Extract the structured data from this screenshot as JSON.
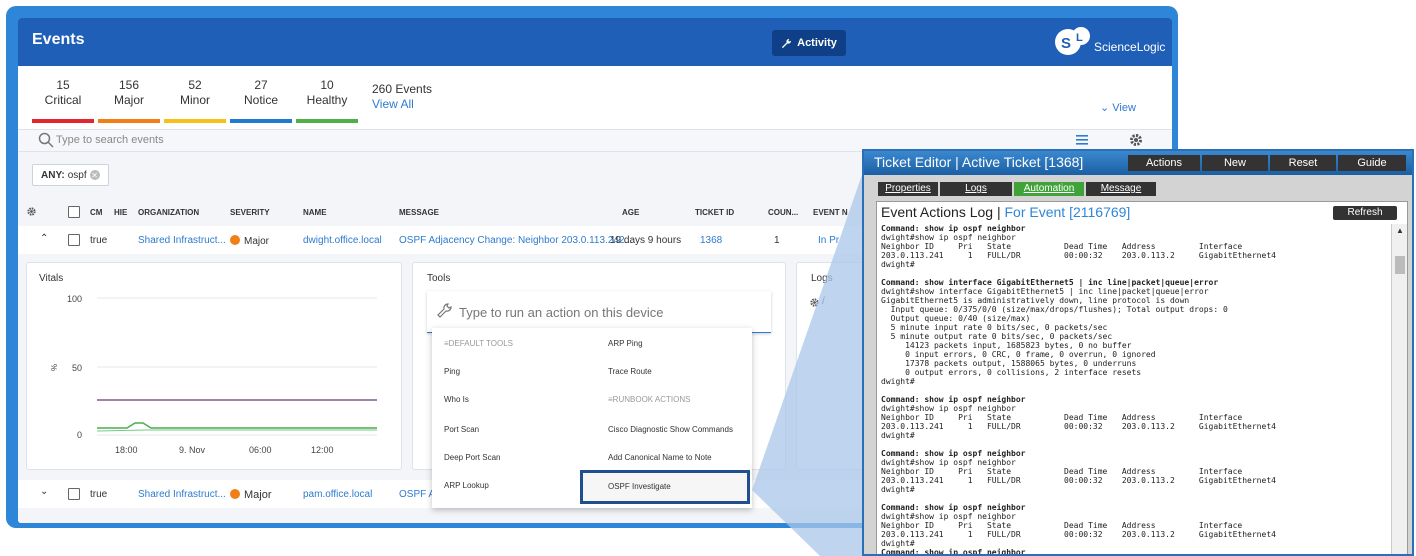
{
  "header": {
    "title": "Events",
    "activity_label": "Activity",
    "logo_text": "ScienceLogic"
  },
  "counts": [
    {
      "value": "15",
      "label": "Critical",
      "color": "#e3262e"
    },
    {
      "value": "156",
      "label": "Major",
      "color": "#f07f17"
    },
    {
      "value": "52",
      "label": "Minor",
      "color": "#f4c21b"
    },
    {
      "value": "27",
      "label": "Notice",
      "color": "#1f7ad1"
    },
    {
      "value": "10",
      "label": "Healthy",
      "color": "#4fb04a"
    }
  ],
  "totals": {
    "events": "260 Events",
    "view_all": "View All",
    "view": "View"
  },
  "search": {
    "placeholder": "Type to search events"
  },
  "filter": {
    "key": "ANY:",
    "value": "ospf"
  },
  "columns": [
    "CM",
    "HIE",
    "ORGANIZATION",
    "SEVERITY",
    "NAME",
    "MESSAGE",
    "AGE",
    "TICKET ID",
    "COUN...",
    "EVENT N"
  ],
  "rows": [
    {
      "cm": "true",
      "org": "Shared Infrastruct...",
      "severity": "Major",
      "name": "dwight.office.local",
      "message": "OSPF Adjacency Change: Neighbor 203.0.113.242...",
      "age": "19 days 9 hours",
      "ticket": "1368",
      "count": "1",
      "event_note": "In Pr"
    },
    {
      "cm": "true",
      "org": "Shared Infrastruct...",
      "severity": "Major",
      "name": "pam.office.local",
      "message": "OSPF A"
    }
  ],
  "vitals": {
    "title": "Vitals",
    "y_labels": [
      "100",
      "50",
      "0"
    ],
    "y_unit": "%",
    "x_labels": [
      "18:00",
      "9. Nov",
      "06:00",
      "12:00"
    ]
  },
  "tools": {
    "title": "Tools",
    "placeholder": "Type to run an action on this device",
    "items_left": [
      "DEFAULT TOOLS",
      "Ping",
      "Who Is",
      "Port Scan",
      "Deep Port Scan",
      "ARP Lookup"
    ],
    "items_right": [
      "ARP Ping",
      "Trace Route",
      "RUNBOOK ACTIONS",
      "Cisco Diagnostic Show Commands",
      "Add Canonical Name to Note",
      "OSPF Investigate"
    ]
  },
  "logs": {
    "title": "Logs"
  },
  "ticket": {
    "title": "Ticket Editor | Active Ticket [1368]",
    "buttons": [
      "Actions",
      "New",
      "Reset",
      "Guide"
    ],
    "tabs": [
      "Properties",
      "Logs",
      "Automation",
      "Message"
    ],
    "log_title": "Event Actions Log |",
    "log_event": "For Event [2116769]",
    "refresh": "Refresh",
    "log_lines": [
      "Command: show ip ospf neighbor",
      "dwight#show ip ospf neighbor",
      "Neighbor ID     Pri   State           Dead Time   Address         Interface",
      "203.0.113.241     1   FULL/DR         00:00:32    203.0.113.2     GigabitEthernet4",
      "dwight#",
      "",
      "Command: show interface GigabitEthernet5 | inc line|packet|queue|error",
      "dwight#show interface GigabitEthernet5 | inc line|packet|queue|error",
      "GigabitEthernet5 is administratively down, line protocol is down",
      "  Input queue: 0/375/0/0 (size/max/drops/flushes); Total output drops: 0",
      "  Output queue: 0/40 (size/max)",
      "  5 minute input rate 0 bits/sec, 0 packets/sec",
      "  5 minute output rate 0 bits/sec, 0 packets/sec",
      "     14123 packets input, 1685823 bytes, 0 no buffer",
      "     0 input errors, 0 CRC, 0 frame, 0 overrun, 0 ignored",
      "     17378 packets output, 1588065 bytes, 0 underruns",
      "     0 output errors, 0 collisions, 2 interface resets",
      "dwight#",
      "",
      "Command: show ip ospf neighbor",
      "dwight#show ip ospf neighbor",
      "Neighbor ID     Pri   State           Dead Time   Address         Interface",
      "203.0.113.241     1   FULL/DR         00:00:32    203.0.113.2     GigabitEthernet4",
      "dwight#",
      "",
      "Command: show ip ospf neighbor",
      "dwight#show ip ospf neighbor",
      "Neighbor ID     Pri   State           Dead Time   Address         Interface",
      "203.0.113.241     1   FULL/DR         00:00:32    203.0.113.2     GigabitEthernet4",
      "dwight#",
      "",
      "Command: show ip ospf neighbor",
      "dwight#show ip ospf neighbor",
      "Neighbor ID     Pri   State           Dead Time   Address         Interface",
      "203.0.113.241     1   FULL/DR         00:00:32    203.0.113.2     GigabitEthernet4",
      "dwight#",
      "Command: show ip ospf neighbor"
    ]
  },
  "colors": {
    "brand_blue": "#1f5fb8",
    "frame_blue": "#2e86d8",
    "link": "#2e7bcf",
    "major": "#f07f17",
    "automation_tab": "#3fa33a"
  }
}
